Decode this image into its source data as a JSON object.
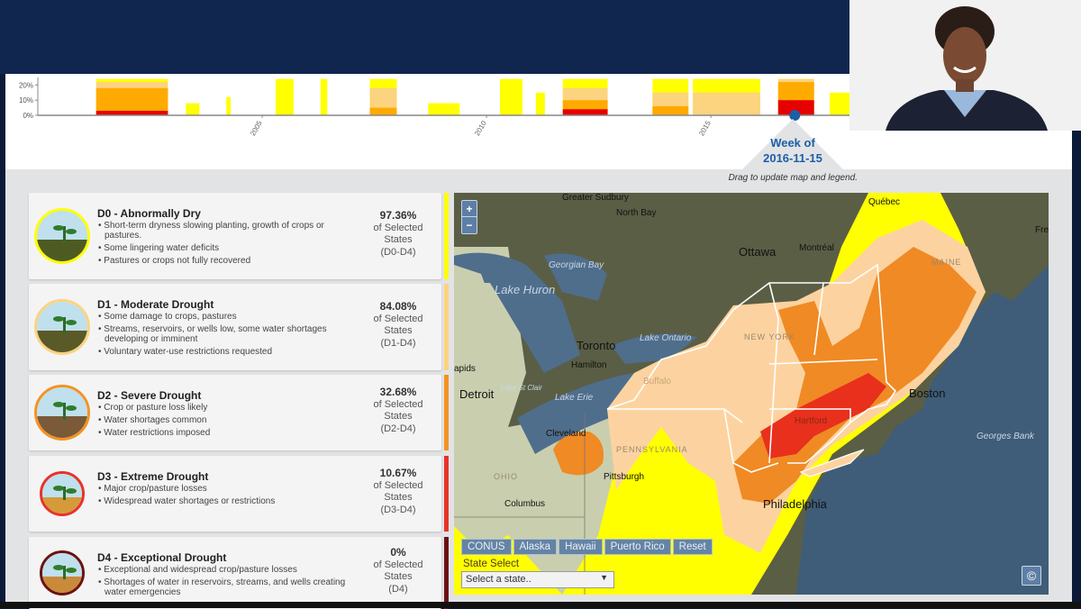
{
  "timeline": {
    "week_label": "Week of",
    "week_date": "2016-11-15",
    "hint": "Drag to update map and legend."
  },
  "chart_data": {
    "type": "area",
    "title": "",
    "xlabel": "",
    "ylabel": "",
    "xlim": [
      2000.0,
      2018.15
    ],
    "ylim": [
      0,
      25
    ],
    "yticks": [
      "0%",
      "10%",
      "20%"
    ],
    "ytick_values": [
      0,
      10,
      20
    ],
    "xticks": [
      "2005",
      "2010",
      "2015"
    ],
    "xtick_values": [
      2005,
      2010,
      2015
    ],
    "series_colors": {
      "D0": "#ffff00",
      "D1": "#fcd37f",
      "D2": "#ffaa00",
      "D3": "#e60000"
    },
    "episodes": [
      {
        "start": 2001.3,
        "end": 2002.9,
        "D0": 24,
        "D1": 22,
        "D2": 18,
        "D3": 3
      },
      {
        "start": 2003.3,
        "end": 2003.6,
        "D0": 8,
        "D1": 0,
        "D2": 0,
        "D3": 0
      },
      {
        "start": 2004.2,
        "end": 2004.3,
        "D0": 12,
        "D1": 0,
        "D2": 0,
        "D3": 0
      },
      {
        "start": 2005.3,
        "end": 2005.7,
        "D0": 24,
        "D1": 0,
        "D2": 0,
        "D3": 0
      },
      {
        "start": 2006.3,
        "end": 2006.45,
        "D0": 24,
        "D1": 0,
        "D2": 0,
        "D3": 0
      },
      {
        "start": 2007.4,
        "end": 2008.0,
        "D0": 24,
        "D1": 18,
        "D2": 5,
        "D3": 0
      },
      {
        "start": 2008.7,
        "end": 2009.4,
        "D0": 8,
        "D1": 0,
        "D2": 0,
        "D3": 0
      },
      {
        "start": 2010.3,
        "end": 2010.8,
        "D0": 24,
        "D1": 0,
        "D2": 0,
        "D3": 0
      },
      {
        "start": 2011.1,
        "end": 2011.3,
        "D0": 15,
        "D1": 0,
        "D2": 0,
        "D3": 0
      },
      {
        "start": 2011.7,
        "end": 2012.7,
        "D0": 24,
        "D1": 18,
        "D2": 10,
        "D3": 4
      },
      {
        "start": 2013.7,
        "end": 2014.5,
        "D0": 24,
        "D1": 15,
        "D2": 6,
        "D3": 0
      },
      {
        "start": 2014.6,
        "end": 2016.1,
        "D0": 24,
        "D1": 15,
        "D2": 0,
        "D3": 0
      },
      {
        "start": 2016.5,
        "end": 2017.3,
        "D0": 24,
        "D1": 24,
        "D2": 22,
        "D3": 10
      },
      {
        "start": 2017.65,
        "end": 2018.15,
        "D0": 15,
        "D1": 0,
        "D2": 0,
        "D3": 0
      }
    ],
    "selected_week": 2016.87
  },
  "legend": [
    {
      "title": "D0 - Abnormally Dry",
      "color": "#ffff00",
      "soil": "#4d5b22",
      "items": [
        "Short-term dryness slowing planting, growth of crops or pastures.",
        "Some lingering water deficits",
        "Pastures or crops not fully recovered"
      ],
      "pct": "97.36%",
      "of": "of Selected",
      "states": "States",
      "range": "(D0-D4)"
    },
    {
      "title": "D1 - Moderate Drought",
      "color": "#fcd37f",
      "soil": "#5a5a28",
      "items": [
        "Some damage to crops, pastures",
        "Streams, reservoirs, or wells low, some water shortages developing or imminent",
        "Voluntary water-use restrictions requested"
      ],
      "pct": "84.08%",
      "of": "of Selected",
      "states": "States",
      "range": "(D1-D4)"
    },
    {
      "title": "D2 - Severe Drought",
      "color": "#f39322",
      "soil": "#7a5a38",
      "items": [
        "Crop or pasture loss likely",
        "Water shortages common",
        "Water restrictions imposed"
      ],
      "pct": "32.68%",
      "of": "of Selected",
      "states": "States",
      "range": "(D2-D4)"
    },
    {
      "title": "D3 - Extreme Drought",
      "color": "#e8322a",
      "soil": "#d59a3a",
      "items": [
        "Major crop/pasture losses",
        "Widespread water shortages or restrictions"
      ],
      "pct": "10.67%",
      "of": "of Selected",
      "states": "States",
      "range": "(D3-D4)"
    },
    {
      "title": "D4 - Exceptional Drought",
      "color": "#6b1212",
      "soil": "#c98a3a",
      "items": [
        "Exceptional and widespread crop/pasture losses",
        "Shortages of water in reservoirs, streams, and wells creating water emergencies"
      ],
      "pct": "0%",
      "of": "of Selected",
      "states": "States",
      "range": "(D4)"
    }
  ],
  "map": {
    "zoom_in": "+",
    "zoom_out": "−",
    "places": {
      "sudbury": "Greater Sudbury",
      "northbay": "North Bay",
      "quebec": "Québec",
      "ottawa": "Ottawa",
      "montreal": "Montréal",
      "toronto": "Toronto",
      "hamilton": "Hamilton",
      "detroit": "Detroit",
      "cleveland": "Cleveland",
      "pittsburgh": "Pittsburgh",
      "columbus": "Columbus",
      "boston": "Boston",
      "philadelphia": "Philadelphia",
      "buffalo": "Buffalo",
      "hartford": "Hartford",
      "rapids": "apids",
      "fre": "Fre"
    },
    "water": {
      "georgian": "Georgian Bay",
      "huron": "Lake Huron",
      "ontario": "Lake Ontario",
      "erie": "Lake Erie",
      "stclair": "Lake St Clair",
      "georges": "Georges Bank"
    },
    "states": {
      "ny": "NEW YORK",
      "pa": "PENNSYLVANIA",
      "oh": "OHIO",
      "me": "MAINE"
    },
    "regions": [
      "CONUS",
      "Alaska",
      "Hawaii",
      "Puerto Rico",
      "Reset"
    ],
    "state_select_label": "State Select",
    "state_select_value": "Select a state..",
    "copyright": "©"
  }
}
